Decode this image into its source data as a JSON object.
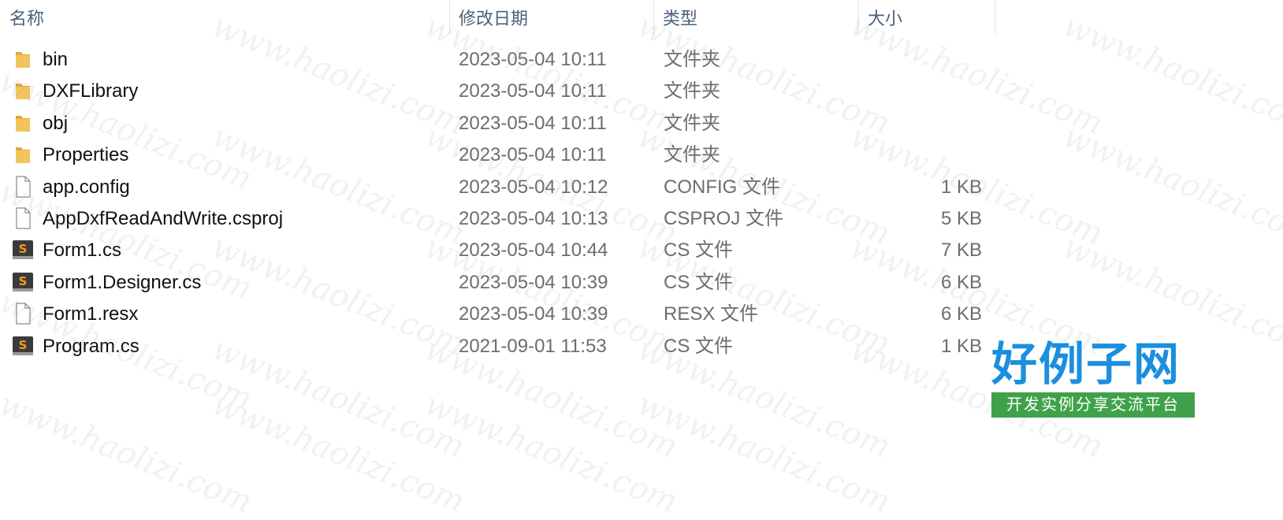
{
  "columns": {
    "name": "名称",
    "date": "修改日期",
    "type": "类型",
    "size": "大小"
  },
  "files": [
    {
      "name": "bin",
      "date": "2023-05-04 10:11",
      "type": "文件夹",
      "size": "",
      "icon": "folder-icon"
    },
    {
      "name": "DXFLibrary",
      "date": "2023-05-04 10:11",
      "type": "文件夹",
      "size": "",
      "icon": "folder-icon"
    },
    {
      "name": "obj",
      "date": "2023-05-04 10:11",
      "type": "文件夹",
      "size": "",
      "icon": "folder-icon"
    },
    {
      "name": "Properties",
      "date": "2023-05-04 10:11",
      "type": "文件夹",
      "size": "",
      "icon": "folder-icon"
    },
    {
      "name": "app.config",
      "date": "2023-05-04 10:12",
      "type": "CONFIG 文件",
      "size": "1 KB",
      "icon": "file-icon"
    },
    {
      "name": "AppDxfReadAndWrite.csproj",
      "date": "2023-05-04 10:13",
      "type": "CSPROJ 文件",
      "size": "5 KB",
      "icon": "file-icon"
    },
    {
      "name": "Form1.cs",
      "date": "2023-05-04 10:44",
      "type": "CS 文件",
      "size": "7 KB",
      "icon": "sublime-cs-file-icon"
    },
    {
      "name": "Form1.Designer.cs",
      "date": "2023-05-04 10:39",
      "type": "CS 文件",
      "size": "6 KB",
      "icon": "sublime-cs-file-icon"
    },
    {
      "name": "Form1.resx",
      "date": "2023-05-04 10:39",
      "type": "RESX 文件",
      "size": "6 KB",
      "icon": "file-icon"
    },
    {
      "name": "Program.cs",
      "date": "2021-09-01 11:53",
      "type": "CS 文件",
      "size": "1 KB",
      "icon": "sublime-cs-file-icon"
    }
  ],
  "watermark": {
    "text": "www.haolizi.com"
  },
  "logo": {
    "title": "好例子网",
    "subtitle": "开发实例分享交流平台"
  },
  "colors": {
    "folder": "#f2c55c",
    "folder_dark": "#e1a93a",
    "header_text": "#4c607a",
    "logo_blue": "#1a8fe0",
    "logo_green": "#3fa24a"
  }
}
